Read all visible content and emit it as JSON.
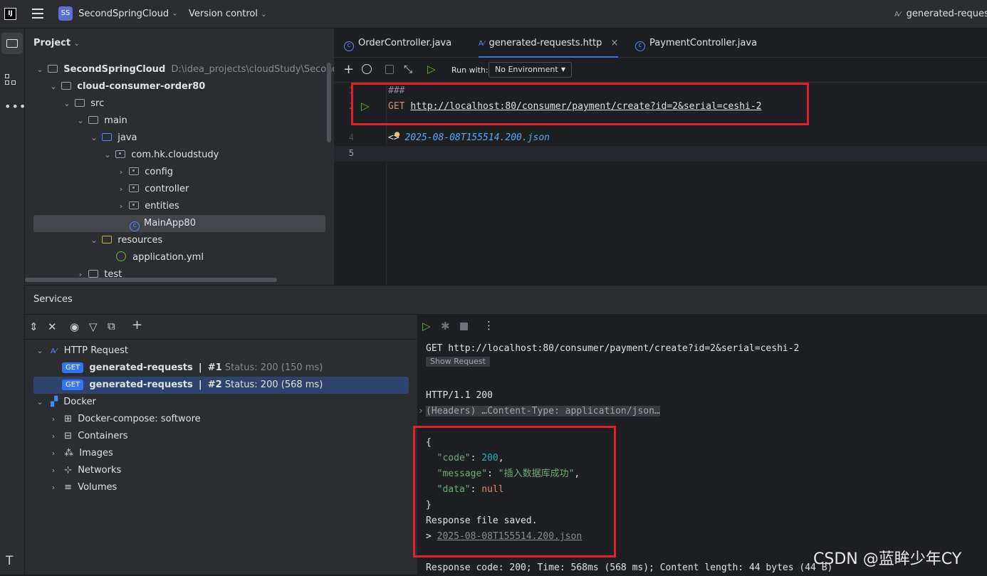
{
  "topbar": {
    "logo": "IJ",
    "project_initials": "SS",
    "project_name": "SecondSpringCloud",
    "vcs": "Version control",
    "right_tab": "generated-reques"
  },
  "project": {
    "title": "Project",
    "root_name": "SecondSpringCloud",
    "root_path": "D:\\idea_projects\\cloudStudy\\SecondSpri",
    "items": [
      {
        "label": "cloud-consumer-order80"
      },
      {
        "label": "src"
      },
      {
        "label": "main"
      },
      {
        "label": "java"
      },
      {
        "label": "com.hk.cloudstudy"
      },
      {
        "label": "config"
      },
      {
        "label": "controller"
      },
      {
        "label": "entities"
      },
      {
        "label": "MainApp80"
      },
      {
        "label": "resources"
      },
      {
        "label": "application.yml"
      },
      {
        "label": "test"
      }
    ]
  },
  "tabs": [
    {
      "label": "OrderController.java"
    },
    {
      "label": "generated-requests.http",
      "close": "×"
    },
    {
      "label": "PaymentController.java"
    }
  ],
  "editor_toolbar": {
    "run_with": "Run with:",
    "environment": "No Environment"
  },
  "editor": {
    "line_numbers": [
      "1",
      "2",
      "4",
      "5"
    ],
    "line1": "###",
    "line2_method": "GET",
    "line2_url": "http://localhost:80/consumer/payment/create?id=2&serial=ceshi-2",
    "line4_prefix": "<>",
    "line4_file": "2025-08-08T155514.200.json"
  },
  "services": {
    "title": "Services",
    "http_request": "HTTP Request",
    "req1": {
      "method": "GET",
      "name": "generated-requests",
      "sep": "|",
      "num": "#1",
      "status": "Status: 200 (150 ms)"
    },
    "req2": {
      "method": "GET",
      "name": "generated-requests",
      "sep": "|",
      "num": "#2",
      "status": "Status: 200 (568 ms)"
    },
    "docker": "Docker",
    "docker_items": [
      "Docker-compose: softwore",
      "Containers",
      "Images",
      "Networks",
      "Volumes"
    ]
  },
  "response": {
    "request_line": "GET http://localhost:80/consumer/payment/create?id=2&serial=ceshi-2",
    "show_request": "Show Request",
    "status_line": "HTTP/1.1 200",
    "headers": "(Headers) …Content-Type: application/json…",
    "open_brace": "{",
    "code_key": "\"code\"",
    "code_val": "200",
    "message_key": "\"message\"",
    "message_val": "\"插入数据库成功\"",
    "data_key": "\"data\"",
    "data_val": "null",
    "close_brace": "}",
    "saved": "Response file saved.",
    "saved_prefix": ">",
    "saved_file": "2025-08-08T155514.200.json",
    "summary": "Response code: 200; Time: 568ms (568 ms); Content length: 44 bytes (44 B)"
  },
  "watermark": "CSDN @蓝眸少年CY"
}
